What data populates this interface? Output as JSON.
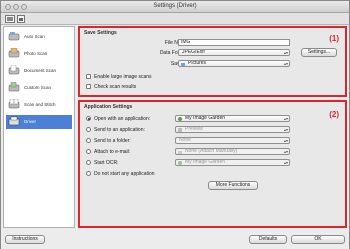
{
  "window": {
    "title": "Settings (Driver)"
  },
  "sidebar": {
    "items": [
      {
        "label": "Auto Scan",
        "icon": "auto-scan-icon"
      },
      {
        "label": "Photo Scan",
        "icon": "photo-scan-icon"
      },
      {
        "label": "Document Scan",
        "icon": "document-scan-icon"
      },
      {
        "label": "Custom Scan",
        "icon": "custom-scan-icon"
      },
      {
        "label": "Scan and Stitch",
        "icon": "scan-and-stitch-icon"
      },
      {
        "label": "Driver",
        "icon": "driver-icon",
        "selected": true
      }
    ]
  },
  "save_settings": {
    "title": "Save Settings",
    "badge": "(1)",
    "file_name_label": "File Name:",
    "file_name_value": "IMG",
    "data_format_label": "Data Format:",
    "data_format_value": "JPEG/Exif",
    "settings_button": "Settings...",
    "save_in_label": "Save in:",
    "save_in_value": "Pictures",
    "enable_large_label": "Enable large image scans",
    "check_results_label": "Check scan results"
  },
  "application_settings": {
    "title": "Application Settings",
    "badge": "(2)",
    "options": [
      {
        "label": "Open with an application:",
        "value": "My Image Garden",
        "selected": true,
        "enabled": true
      },
      {
        "label": "Send to an application:",
        "value": "Preview",
        "selected": false,
        "enabled": false
      },
      {
        "label": "Send to a folder:",
        "value": "None",
        "selected": false,
        "enabled": false
      },
      {
        "label": "Attach to e-mail:",
        "value": "None (Attach Manually)",
        "selected": false,
        "enabled": false
      },
      {
        "label": "Start OCR:",
        "value": "My Image Garden",
        "selected": false,
        "enabled": false
      },
      {
        "label": "Do not start any application",
        "value": "",
        "selected": false,
        "enabled": false
      }
    ],
    "more_functions_button": "More Functions"
  },
  "bottom": {
    "instructions_button": "Instructions",
    "defaults_button": "Defaults",
    "ok_button": "OK"
  },
  "colors": {
    "highlight": "#d7282f",
    "selection": "#4c7fd6"
  }
}
